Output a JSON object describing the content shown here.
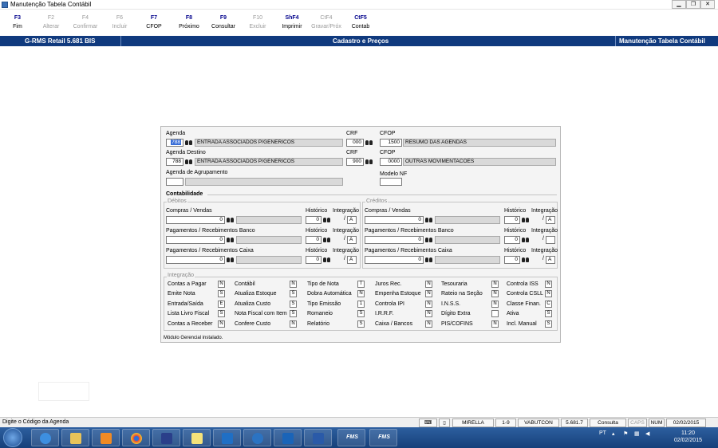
{
  "window": {
    "title": "Manutenção Tabela Contábil"
  },
  "toolbar": [
    {
      "key": "F3",
      "label": "Fim",
      "enabled": true
    },
    {
      "key": "F2",
      "label": "Alterar",
      "enabled": false
    },
    {
      "key": "F4",
      "label": "Confirmar",
      "enabled": false
    },
    {
      "key": "F6",
      "label": "Incluir",
      "enabled": false
    },
    {
      "key": "F7",
      "label": "CFOP",
      "enabled": true
    },
    {
      "key": "F8",
      "label": "Próximo",
      "enabled": true
    },
    {
      "key": "F9",
      "label": "Consultar",
      "enabled": true
    },
    {
      "key": "F10",
      "label": "Excluir",
      "enabled": false
    },
    {
      "key": "ShF4",
      "label": "Imprimir",
      "enabled": true
    },
    {
      "key": "CtF4",
      "label": "Gravar/Próx",
      "enabled": false
    },
    {
      "key": "CtF5",
      "label": "Contab",
      "enabled": true
    }
  ],
  "header": {
    "left": "G-RMS Retail 5.681 BIS",
    "center": "Cadastro e Preços",
    "right": "Manutenção Tabela Contábil"
  },
  "form": {
    "agenda": {
      "label": "Agenda",
      "code": "788",
      "desc": "ENTRADA ASSOCIADOS P/GENERICOS"
    },
    "crf1": {
      "label": "CRF",
      "value": "000"
    },
    "cfop1": {
      "label": "CFOP",
      "code": "1500",
      "desc": "RESUMO DAS AGENDAS"
    },
    "agenda_destino": {
      "label": "Agenda Destino",
      "code": "788",
      "desc": "ENTRADA ASSOCIADOS P/GENERICOS"
    },
    "crf2": {
      "label": "CRF",
      "value": "900"
    },
    "cfop2": {
      "label": "CFOP",
      "code": "0000",
      "desc": "OUTRAS MOVIMENTACOES"
    },
    "agenda_agrupamento": {
      "label": "Agenda de Agrupamento",
      "code": "",
      "desc": ""
    },
    "modelo_nf": {
      "label": "Modelo NF",
      "value": ""
    },
    "contabilidade_title": "Contabilidade",
    "debitos": {
      "title": "Débitos",
      "rows": [
        {
          "label": "Compras / Vendas",
          "conta": "0",
          "hist_label": "Histórico",
          "hist": "0",
          "integ_label": "Integração",
          "integ": "A"
        },
        {
          "label": "Pagamentos / Recebimentos Banco",
          "conta": "0",
          "hist_label": "Histórico",
          "hist": "0",
          "integ_label": "Integração",
          "integ": "A"
        },
        {
          "label": "Pagamentos / Recebimentos Caixa",
          "conta": "0",
          "hist_label": "Histórico",
          "hist": "0",
          "integ_label": "Integração",
          "integ": "A"
        }
      ]
    },
    "creditos": {
      "title": "Créditos",
      "rows": [
        {
          "label": "Compras / Vendas",
          "conta": "0",
          "hist_label": "Histórico",
          "hist": "0",
          "integ_label": "Integração",
          "integ": "A"
        },
        {
          "label": "Pagamentos / Recebimentos Banco",
          "conta": "0",
          "hist_label": "Histórico",
          "hist": "0",
          "integ_label": "Integração",
          "integ": ""
        },
        {
          "label": "Pagamentos / Recebimentos Caixa",
          "conta": "0",
          "hist_label": "Histórico",
          "hist": "0",
          "integ_label": "Integração",
          "integ": "A"
        }
      ]
    },
    "integracao": {
      "title": "Integração",
      "columns": [
        [
          {
            "label": "Contas a Pagar",
            "value": "N"
          },
          {
            "label": "Emite Nota",
            "value": "S"
          },
          {
            "label": "Entrada/Saída",
            "value": "E"
          },
          {
            "label": "Lista Livro Fiscal",
            "value": "S"
          },
          {
            "label": "Contas a Receber",
            "value": "N"
          }
        ],
        [
          {
            "label": "Contábil",
            "value": "N"
          },
          {
            "label": "Atualiza Estoque",
            "value": "S"
          },
          {
            "label": "Atualiza Custo",
            "value": "S"
          },
          {
            "label": "Nota Fiscal com Item",
            "value": "S"
          },
          {
            "label": "Confere Custo",
            "value": "N"
          }
        ],
        [
          {
            "label": "Tipo de Nota",
            "value": "T"
          },
          {
            "label": "Dobra Automática",
            "value": "N"
          },
          {
            "label": "Tipo Emissão",
            "value": "1"
          },
          {
            "label": "Romaneio",
            "value": "S"
          },
          {
            "label": "Relatório",
            "value": "S"
          }
        ],
        [
          {
            "label": "Juros Rec.",
            "value": "N"
          },
          {
            "label": "Empenha Estoque",
            "value": "N"
          },
          {
            "label": "Controla IPI",
            "value": "N"
          },
          {
            "label": "I.R.R.F.",
            "value": "N"
          },
          {
            "label": "Caixa / Bancos",
            "value": "N"
          }
        ],
        [
          {
            "label": "Tesouraria",
            "value": "N"
          },
          {
            "label": "Rateio na Seção",
            "value": "N"
          },
          {
            "label": "I.N.S.S.",
            "value": "N"
          },
          {
            "label": "Dígito Extra",
            "value": ""
          },
          {
            "label": "PIS/COFINS",
            "value": "N"
          }
        ],
        [
          {
            "label": "Controla ISS",
            "value": "N"
          },
          {
            "label": "Controla CSLL",
            "value": "N"
          },
          {
            "label": "Classe Finan.",
            "value": "C"
          },
          {
            "label": "Ativa",
            "value": "S"
          },
          {
            "label": "Incl. Manual",
            "value": "S"
          }
        ]
      ]
    },
    "panel_status": "Módulo Gerencial instalado."
  },
  "statusbar": {
    "message": "Digite o Código da Agenda",
    "cells": [
      "MIRELLA",
      "1-9",
      "VABUTCON",
      "5.681.7",
      "Consulta",
      "CAPS",
      "NUM",
      "02/02/2015"
    ]
  },
  "taskbar": {
    "ms1": "FMS",
    "ms2": "FMS",
    "lang": "PT",
    "time": "11:20",
    "date": "02/02/2015"
  }
}
